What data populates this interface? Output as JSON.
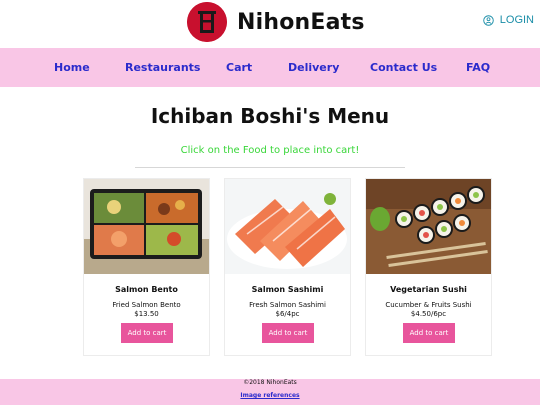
{
  "brand": {
    "name": "NihonEats"
  },
  "header": {
    "login_label": "LOGIN",
    "login_icon": "user-circle-icon"
  },
  "nav": {
    "items": [
      {
        "label": "Home"
      },
      {
        "label": "Restaurants"
      },
      {
        "label": "Cart"
      },
      {
        "label": "Delivery"
      },
      {
        "label": "Contact Us"
      },
      {
        "label": "FAQ"
      }
    ]
  },
  "page": {
    "title": "Ichiban Boshi's Menu",
    "subtitle": "Click on the Food to place into cart!"
  },
  "menu": [
    {
      "name": "Salmon Bento",
      "desc": "Fried Salmon Bento",
      "price": "$13.50",
      "button": "Add to cart"
    },
    {
      "name": "Salmon Sashimi",
      "desc": "Fresh Salmon Sashimi",
      "price": "$6/4pc",
      "button": "Add to cart"
    },
    {
      "name": "Vegetarian Sushi",
      "desc": "Cucumber & Fruits Sushi",
      "price": "$4.50/6pc",
      "button": "Add to cart"
    }
  ],
  "footer": {
    "copyright": "©2018 NihonEats",
    "refs_label": "Image references"
  },
  "colors": {
    "nav_bg": "#f9c6e6",
    "nav_text": "#2b2bcc",
    "subtitle": "#39d639",
    "button": "#e8559c",
    "login": "#1b8ea8",
    "logo": "#c8102e"
  }
}
